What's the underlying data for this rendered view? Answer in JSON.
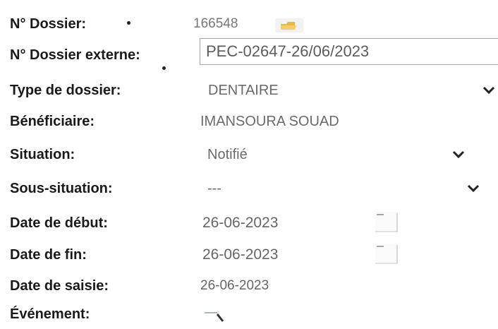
{
  "form": {
    "dossier": {
      "label": "N° Dossier:",
      "value": "166548"
    },
    "dossier_externe": {
      "label": "N° Dossier externe:",
      "value": "PEC-02647-26/06/2023"
    },
    "type_dossier": {
      "label": "Type de dossier:",
      "selected": "DENTAIRE"
    },
    "beneficiaire": {
      "label": "Bénéficiaire:",
      "value": "IMANSOURA SOUAD"
    },
    "situation": {
      "label": "Situation:",
      "selected": "Notifié"
    },
    "sous_situation": {
      "label": "Sous-situation:",
      "selected": "---"
    },
    "date_debut": {
      "label": "Date de début:",
      "value": "26-06-2023"
    },
    "date_fin": {
      "label": "Date de fin:",
      "value": "26-06-2023"
    },
    "date_saisie": {
      "label": "Date de saisie:",
      "value": "26-06-2023"
    },
    "evenement": {
      "label": "Événement:"
    }
  },
  "icons": {
    "folder": "folder-icon",
    "chevron": "chevron-down-icon",
    "calendar": "calendar-icon",
    "search": "search-icon"
  },
  "colors": {
    "label": "#1a1a1a",
    "value": "#6a6a6a",
    "input_border": "#9aa8c0",
    "folder": "#e8b94a"
  }
}
